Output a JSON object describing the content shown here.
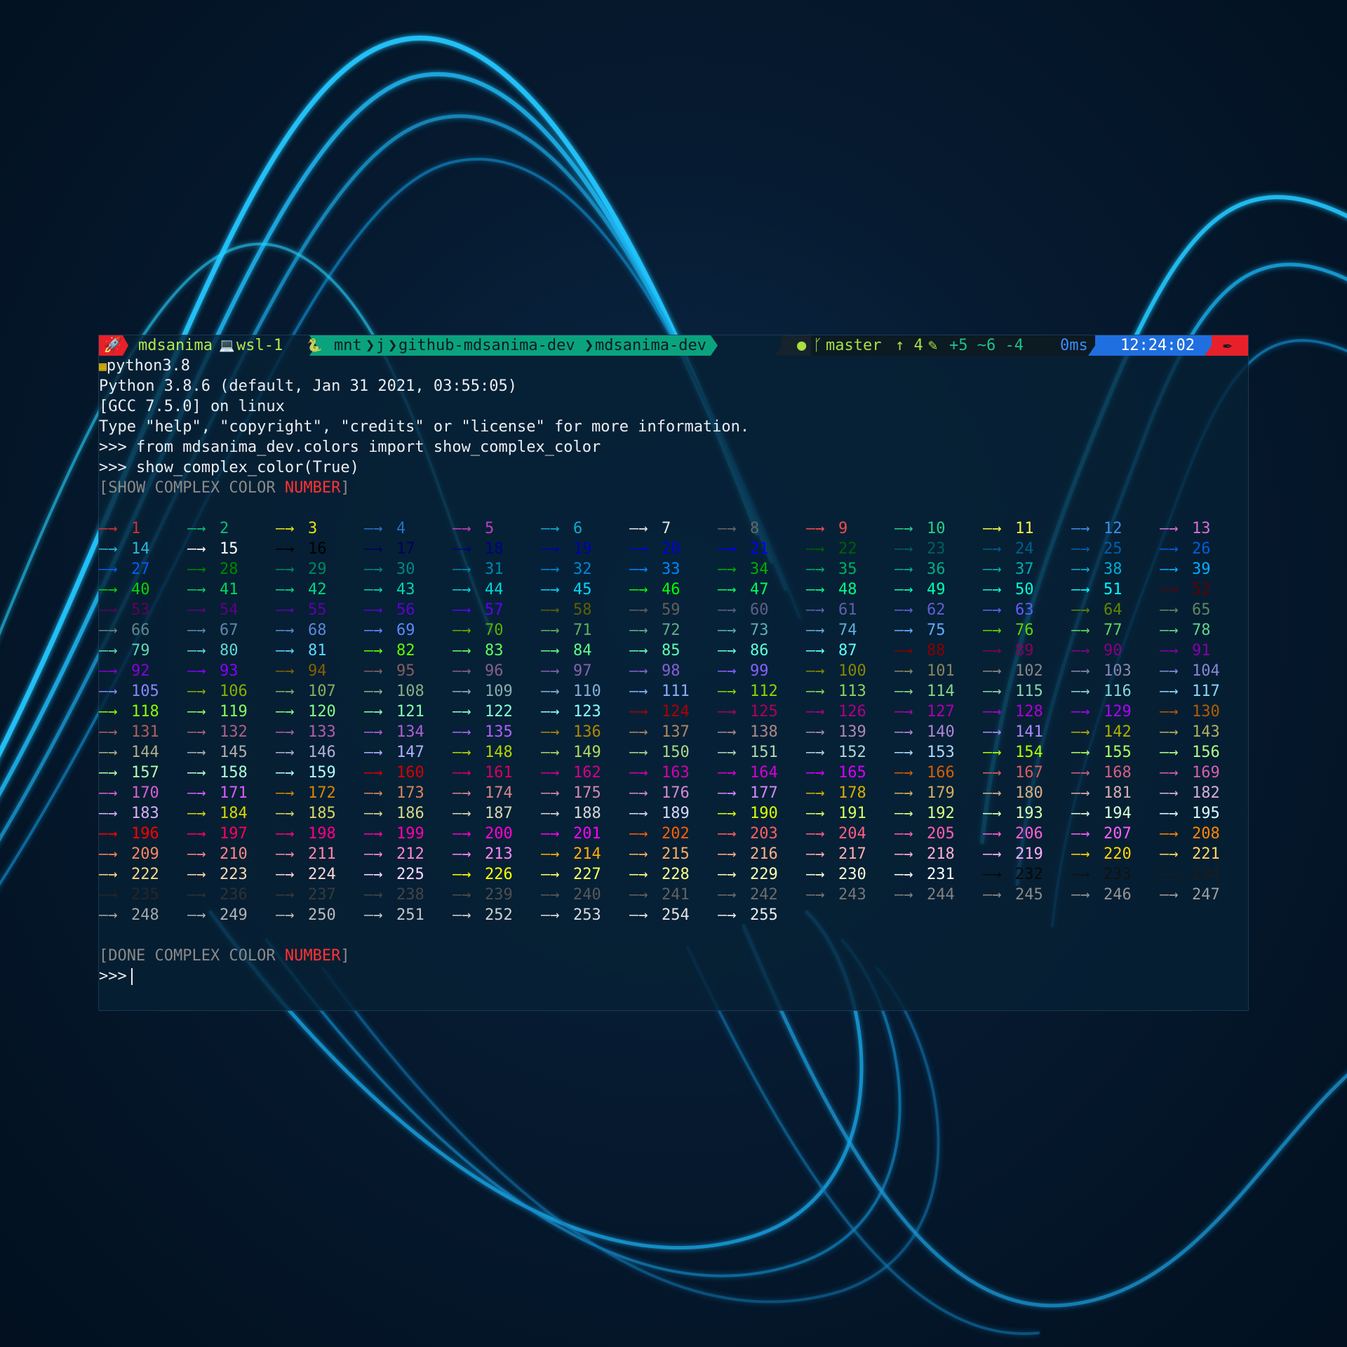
{
  "prompt": {
    "user": "mdsanima",
    "host": "wsl-1",
    "path": [
      "mnt",
      "j",
      "github-mdsanima-dev",
      "mdsanima-dev"
    ],
    "git_branch": "master",
    "git_status": "↑ 4",
    "git_changes": "+5 ~6 -4",
    "exec_time": "0ms",
    "clock": "12:24:02",
    "icons": [
      "rocket-icon",
      "laptop-icon",
      "python-icon",
      "github-icon",
      "branch-icon",
      "edit-icon",
      "pen-icon",
      "construction-icon"
    ]
  },
  "session": {
    "venv": "python3.8",
    "banner": [
      "Python 3.8.6 (default, Jan 31 2021, 03:55:05)",
      "[GCC 7.5.0] on linux",
      "Type \"help\", \"copyright\", \"credits\" or \"license\" for more information."
    ],
    "cmd_prefix": ">>> ",
    "commands": [
      "from mdsanima_dev.colors import show_complex_color",
      "show_complex_color(True)"
    ],
    "show_header": {
      "open": "[",
      "text": "SHOW COMPLEX COLOR ",
      "highlight": "NUMBER",
      "close": "]"
    },
    "done_header": {
      "open": "[",
      "text": "DONE COMPLEX COLOR ",
      "highlight": "NUMBER",
      "close": "]"
    },
    "final_prompt": ">>>"
  },
  "color_table": {
    "arrow": "—→",
    "columns": 13,
    "start": 1,
    "end": 255
  },
  "colors": {
    "text": "#eaeef2",
    "header_gray": "#8a8a8a",
    "number_red": "#ff3333",
    "seg_red": "#e8202a",
    "seg_green": "#0aa37e",
    "seg_dark": "#0c1a22",
    "seg_blue": "#1f6fe0"
  }
}
